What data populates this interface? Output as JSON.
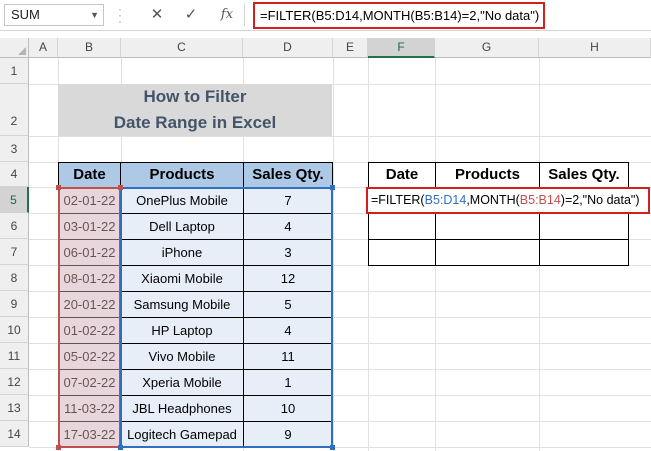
{
  "namebox": {
    "value": "SUM"
  },
  "formula_bar": {
    "formula": "=FILTER(B5:D14,MONTH(B5:B14)=2,\"No data\")",
    "cancel_icon": "close-icon",
    "enter_icon": "check-icon",
    "function_label": "fx"
  },
  "columns": [
    "A",
    "B",
    "C",
    "D",
    "E",
    "F",
    "G",
    "H"
  ],
  "rows": [
    "1",
    "2",
    "3",
    "4",
    "5",
    "6",
    "7",
    "8",
    "9",
    "10",
    "11",
    "12",
    "13",
    "14"
  ],
  "title": {
    "line1": "How to Filter",
    "line2": "Date Range in Excel"
  },
  "source_table": {
    "headers": [
      "Date",
      "Products",
      "Sales Qty."
    ],
    "rows": [
      [
        "02-01-22",
        "OnePlus Mobile",
        "7"
      ],
      [
        "03-01-22",
        "Dell Laptop",
        "4"
      ],
      [
        "06-01-22",
        "iPhone",
        "3"
      ],
      [
        "08-01-22",
        "Xiaomi Mobile",
        "12"
      ],
      [
        "20-01-22",
        "Samsung Mobile",
        "5"
      ],
      [
        "01-02-22",
        "HP Laptop",
        "4"
      ],
      [
        "05-02-22",
        "Vivo Mobile",
        "11"
      ],
      [
        "07-02-22",
        "Xperia Mobile",
        "1"
      ],
      [
        "11-03-22",
        "JBL Headphones",
        "10"
      ],
      [
        "17-03-22",
        "Logitech Gamepad",
        "9"
      ]
    ]
  },
  "output_table": {
    "headers": [
      "Date",
      "Products",
      "Sales Qty."
    ],
    "edit_formula": {
      "p1": "=FILTER(",
      "p2": "B5:D14",
      "p3": ",MONTH(",
      "p4": "B5:B14",
      "p5": ")=2,\"No data\")"
    }
  },
  "colors": {
    "accent": "#217346",
    "header_fill": "#aec9e6",
    "data_fill": "#e7eef8",
    "highlight": "#d21f1f"
  }
}
